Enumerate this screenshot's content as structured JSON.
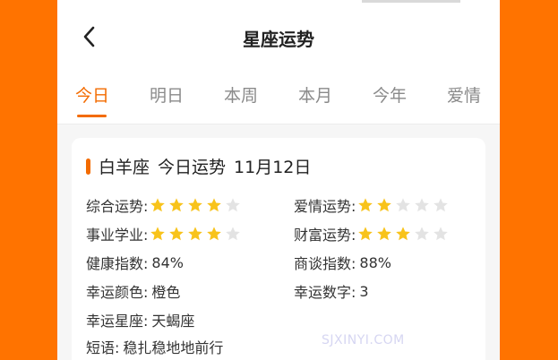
{
  "header": {
    "title": "星座运势"
  },
  "tabs": [
    {
      "label": "今日"
    },
    {
      "label": "明日"
    },
    {
      "label": "本周"
    },
    {
      "label": "本月"
    },
    {
      "label": "今年"
    },
    {
      "label": "爱情"
    }
  ],
  "card": {
    "sign": "白羊座",
    "section": "今日运势",
    "date": "11月12日",
    "overall": {
      "label": "综合运势:",
      "stars": 4,
      "max": 5
    },
    "love": {
      "label": "爱情运势:",
      "stars": 2,
      "max": 5
    },
    "career": {
      "label": "事业学业:",
      "stars": 4,
      "max": 5
    },
    "wealth": {
      "label": "财富运势:",
      "stars": 3,
      "max": 5
    },
    "health": {
      "label": "健康指数:",
      "value": "84%"
    },
    "negotiation": {
      "label": "商谈指数:",
      "value": "88%"
    },
    "lucky_color": {
      "label": "幸运颜色:",
      "value": "橙色"
    },
    "lucky_number": {
      "label": "幸运数字:",
      "value": "3"
    },
    "lucky_sign": {
      "label": "幸运星座:",
      "value": "天蝎座"
    },
    "motto": {
      "label": "短语:",
      "value": "稳扎稳地地前行"
    }
  },
  "watermark": "SJXINYI.COM",
  "colors": {
    "accent": "#f36b00",
    "star_on": "#f8c31b",
    "star_off": "#e3e3e3",
    "page_bg": "#ff7300"
  }
}
